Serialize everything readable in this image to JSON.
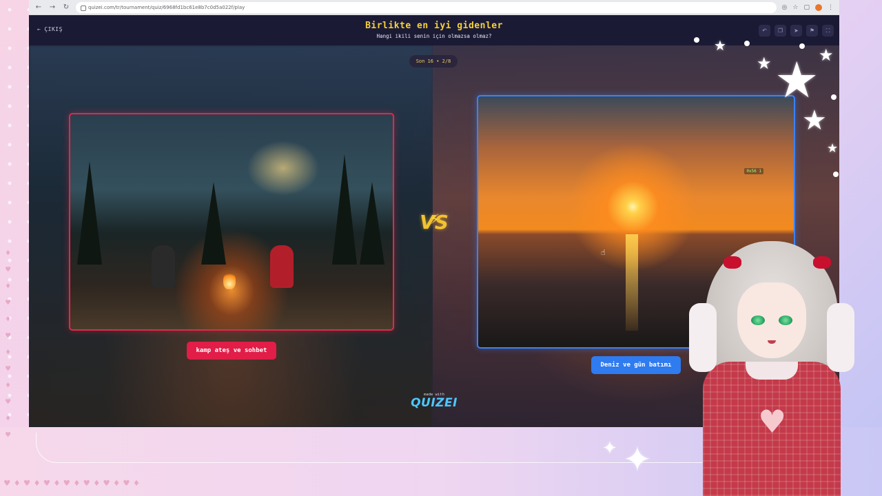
{
  "browser": {
    "url": "quizei.com/tr/tournament/quiz/6968fd1bc61e8b7c0d5a022f/play",
    "back_icon": "arrow-left-icon",
    "forward_icon": "arrow-right-icon",
    "reload_icon": "reload-icon"
  },
  "header": {
    "back_label": "ÇIKIŞ",
    "title": "Birlikte en iyi gidenler",
    "subtitle": "Hangi ikili senin için olmazsa olmaz?"
  },
  "round": {
    "label": "Son 16 • 2/8"
  },
  "choices": [
    {
      "label": "kamp ateş ve sohbet",
      "accent": "#e11d48"
    },
    {
      "label": "Deniz ve gün batımı",
      "accent": "#2f7bf0"
    }
  ],
  "vs_label": "VS",
  "badge_text": "0x56 1",
  "footer": {
    "made_with": "made with",
    "logo": "QUIZEI"
  },
  "colors": {
    "title": "#f6d23a",
    "topbar": "#1b1a35",
    "left_border": "#e0294a",
    "right_border": "#3b82f6"
  }
}
